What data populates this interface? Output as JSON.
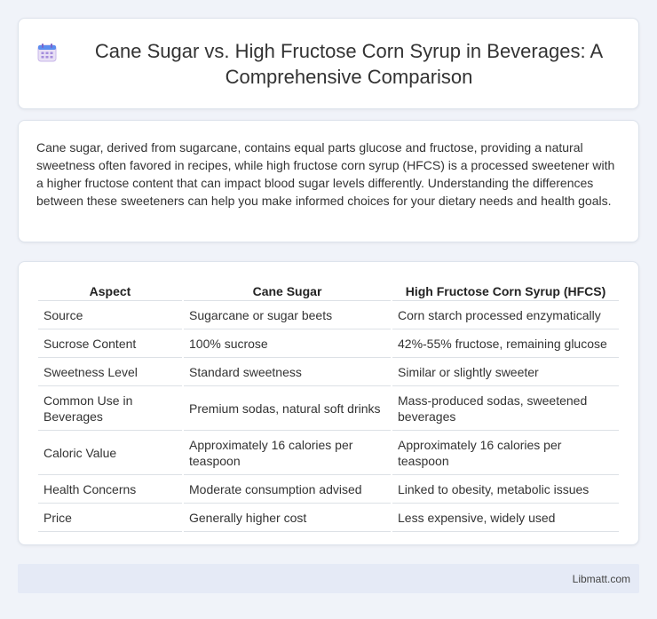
{
  "header": {
    "title": "Cane Sugar vs. High Fructose Corn Syrup in Beverages: A Comprehensive Comparison",
    "icon": "calendar-icon"
  },
  "intro": {
    "text": "Cane sugar, derived from sugarcane, contains equal parts glucose and fructose, providing a natural sweetness often favored in recipes, while high fructose corn syrup (HFCS) is a processed sweetener with a higher fructose content that can impact blood sugar levels differently. Understanding the differences between these sweeteners can help you make informed choices for your dietary needs and health goals."
  },
  "table": {
    "headers": [
      "Aspect",
      "Cane Sugar",
      "High Fructose Corn Syrup (HFCS)"
    ],
    "rows": [
      [
        "Source",
        "Sugarcane or sugar beets",
        "Corn starch processed enzymatically"
      ],
      [
        "Sucrose Content",
        "100% sucrose",
        "42%-55% fructose, remaining glucose"
      ],
      [
        "Sweetness Level",
        "Standard sweetness",
        "Similar or slightly sweeter"
      ],
      [
        "Common Use in Beverages",
        "Premium sodas, natural soft drinks",
        "Mass-produced sodas, sweetened beverages"
      ],
      [
        "Caloric Value",
        "Approximately 16 calories per teaspoon",
        "Approximately 16 calories per teaspoon"
      ],
      [
        "Health Concerns",
        "Moderate consumption advised",
        "Linked to obesity, metabolic issues"
      ],
      [
        "Price",
        "Generally higher cost",
        "Less expensive, widely used"
      ]
    ]
  },
  "footer": {
    "brand": "Libmatt.com"
  }
}
